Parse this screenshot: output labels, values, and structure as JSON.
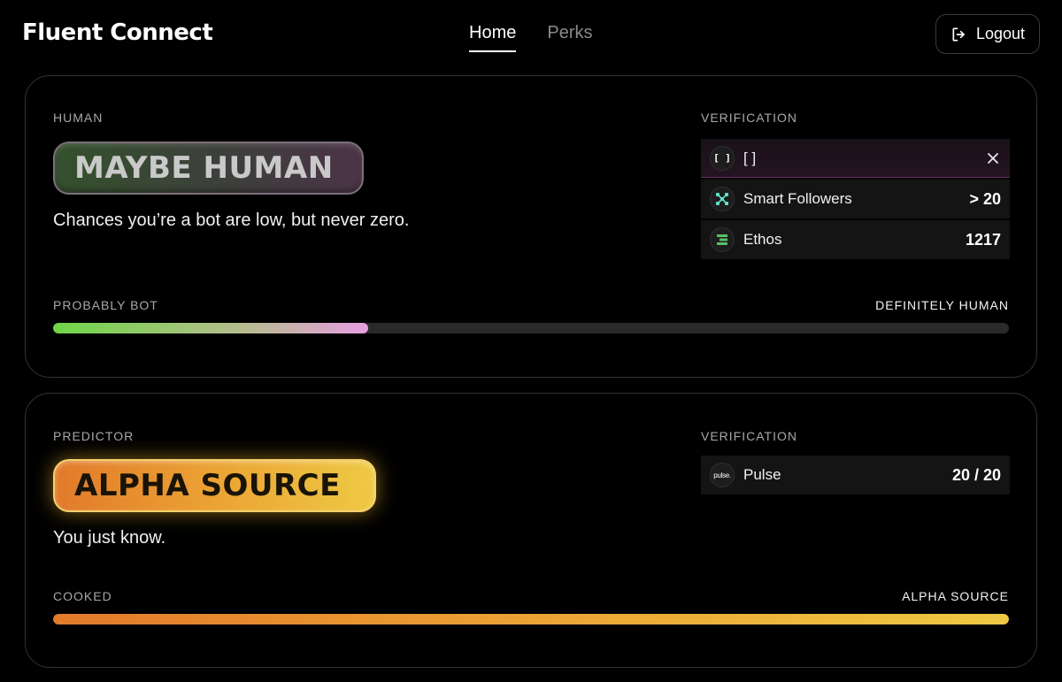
{
  "header": {
    "brand": "Fluent Connect",
    "tabs": [
      {
        "label": "Home",
        "active": true
      },
      {
        "label": "Perks",
        "active": false
      }
    ],
    "logout_label": "Logout"
  },
  "human_card": {
    "section_label": "HUMAN",
    "badge": "MAYBE HUMAN",
    "tagline": "Chances you’re a bot are low, but never zero.",
    "verification_label": "VERIFICATION",
    "verifications": [
      {
        "icon": "bracket-icon",
        "icon_text": "[ ]",
        "name": "[ ]",
        "value": "",
        "highlight": true
      },
      {
        "icon": "smart-followers-icon",
        "name": "Smart Followers",
        "value": "> 20"
      },
      {
        "icon": "ethos-icon",
        "name": "Ethos",
        "value": "1217"
      }
    ],
    "scale_left": "PROBABLY BOT",
    "scale_right": "DEFINITELY HUMAN",
    "progress_percent": 33
  },
  "predictor_card": {
    "section_label": "PREDICTOR",
    "badge": "ALPHA SOURCE",
    "tagline": "You just know.",
    "verification_label": "VERIFICATION",
    "verifications": [
      {
        "icon": "pulse-icon",
        "icon_text": "pulse.",
        "name": "Pulse",
        "value": "20 / 20"
      }
    ],
    "scale_left": "COOKED",
    "scale_right": "ALPHA SOURCE",
    "progress_percent": 100
  },
  "colors": {
    "human_fill_start": "#6fd548",
    "human_fill_end": "#e69fe0",
    "predictor_fill_start": "#e27a2b",
    "predictor_fill_end": "#eec944"
  }
}
